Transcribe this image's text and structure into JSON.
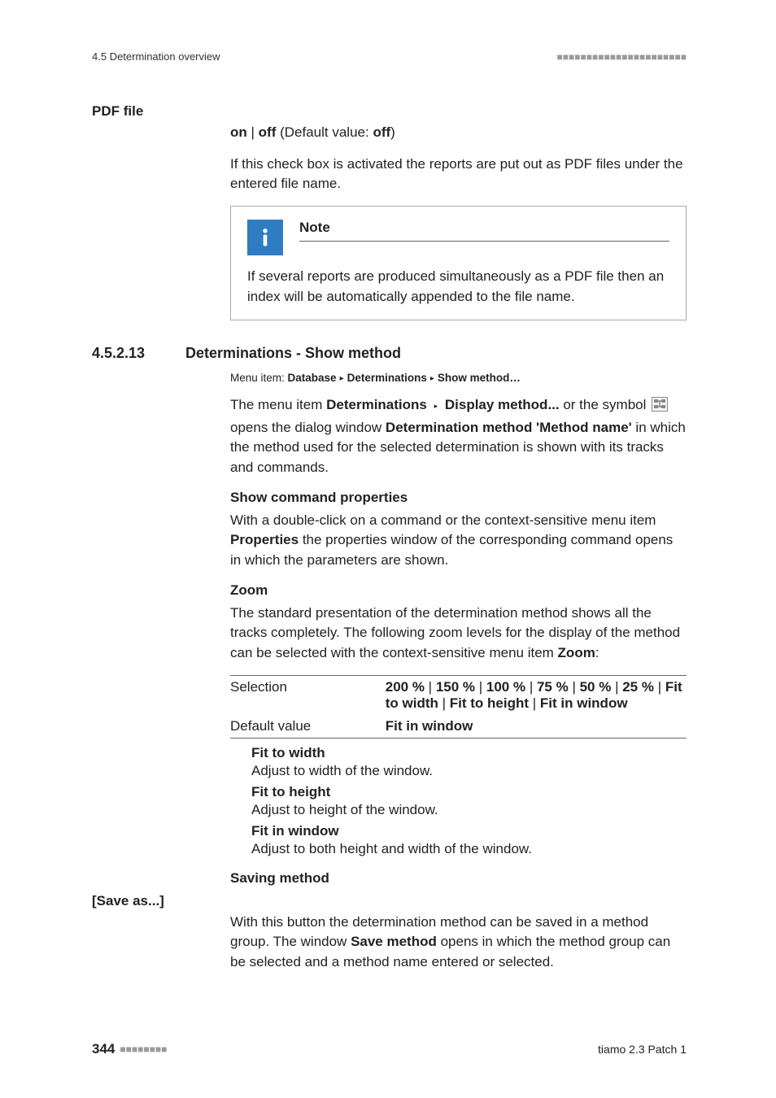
{
  "header": {
    "left": "4.5 Determination overview",
    "dots": "■■■■■■■■■■■■■■■■■■■■■■"
  },
  "pdf": {
    "side": "PDF file",
    "on": "on",
    "off": "off",
    "default_label": " (Default value: ",
    "default_close": ")",
    "default_value": "off",
    "body": "If this check box is activated the reports are put out as PDF files under the entered file name."
  },
  "note": {
    "title": "Note",
    "body": "If several reports are produced simultaneously as a PDF file then an index will be automatically appended to the file name."
  },
  "section": {
    "number": "4.5.2.13",
    "title": "Determinations - Show method",
    "menu_prefix": "Menu item: ",
    "menu_b1": "Database",
    "arrow": "▸",
    "menu_b2": "Determinations",
    "menu_b3": "Show method…",
    "intro_a": "The menu item ",
    "intro_b1": "Determinations",
    "tri": "▸",
    "intro_b2": "Display method...",
    "intro_c": " or the symbol ",
    "intro_d": "opens the dialog window ",
    "intro_e": "Determination method 'Method name'",
    "intro_f": " in which the method used for the selected determination is shown with its tracks and commands."
  },
  "show_cmd": {
    "title": "Show command properties",
    "body_a": "With a double-click on a command or the context-sensitive menu item ",
    "body_b": "Properties",
    "body_c": " the properties window of the corresponding command opens in which the parameters are shown."
  },
  "zoom": {
    "title": "Zoom",
    "body_a": "The standard presentation of the determination method shows all the tracks completely. The following zoom levels for the display of the method can be selected with the context-sensitive menu item ",
    "body_b": "Zoom",
    "body_c": ":",
    "table": {
      "selection_label": "Selection",
      "default_label": "Default value",
      "sel_vals": [
        "200 %",
        "150 %",
        "100 %",
        "75 %",
        "50 %",
        "25 %",
        "Fit to width",
        "Fit to height",
        "Fit in window"
      ],
      "default_value": "Fit in window"
    },
    "options": [
      {
        "term": "Fit to width",
        "desc": "Adjust to width of the window."
      },
      {
        "term": "Fit to height",
        "desc": "Adjust to height of the window."
      },
      {
        "term": "Fit in window",
        "desc": "Adjust to both height and width of the window."
      }
    ]
  },
  "saving": {
    "title": "Saving method",
    "side": "[Save as...]",
    "body_a": "With this button the determination method can be saved in a method group. The window ",
    "body_b": "Save method",
    "body_c": " opens in which the method group can be selected and a method name entered or selected."
  },
  "footer": {
    "page": "344",
    "dots": "■■■■■■■■",
    "right": "tiamo 2.3 Patch 1"
  }
}
